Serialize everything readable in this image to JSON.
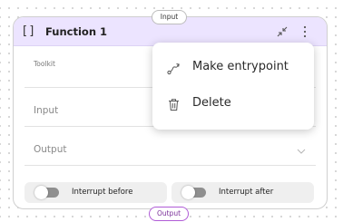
{
  "node": {
    "icon": "brackets-icon",
    "title": "Function 1",
    "toolkit_label": "Toolkit",
    "input_label": "Input",
    "output_label": "Output"
  },
  "toggles": [
    {
      "label": "Interrupt before",
      "on": false
    },
    {
      "label": "Interrupt after",
      "on": false
    }
  ],
  "ports": {
    "input": "Input",
    "output": "Output"
  },
  "context_menu": {
    "items": [
      {
        "label": "Make entrypoint",
        "icon": "entrypoint-icon"
      },
      {
        "label": "Delete",
        "icon": "trash-icon"
      }
    ]
  },
  "colors": {
    "header_bg": "#ece4ff",
    "output_port_border": "#b05cd6",
    "toggle_off": "#8f8f8f"
  }
}
